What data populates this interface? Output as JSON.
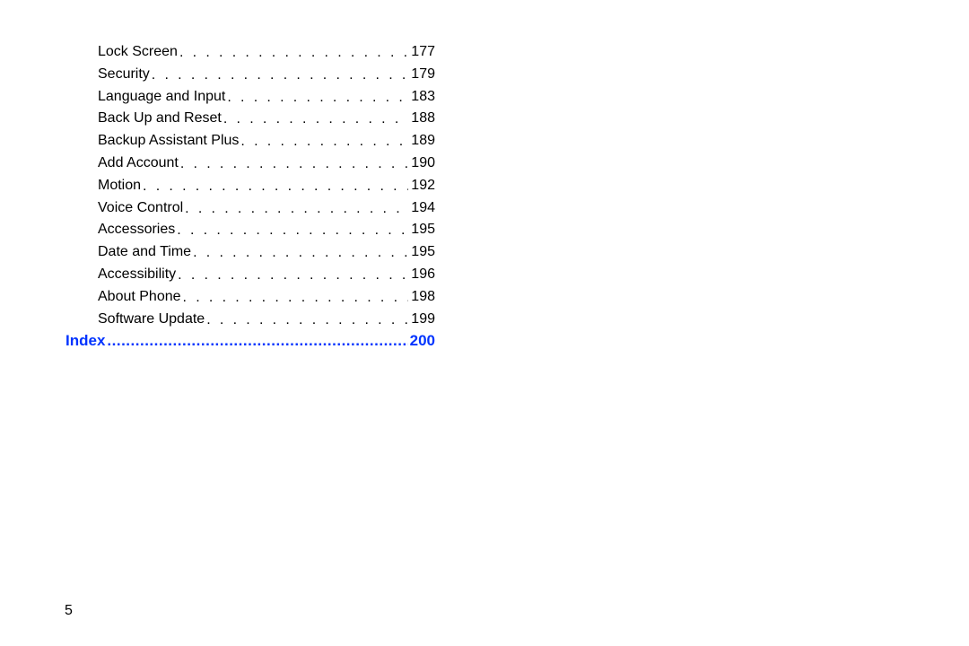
{
  "toc": {
    "entries": [
      {
        "title": "Lock Screen ",
        "page": "177"
      },
      {
        "title": "Security",
        "page": "179"
      },
      {
        "title": "Language and Input",
        "page": "183"
      },
      {
        "title": "Back Up and Reset ",
        "page": "188"
      },
      {
        "title": "Backup Assistant Plus ",
        "page": "189"
      },
      {
        "title": "Add Account ",
        "page": "190"
      },
      {
        "title": "Motion",
        "page": "192"
      },
      {
        "title": "Voice Control",
        "page": "194"
      },
      {
        "title": "Accessories",
        "page": "195"
      },
      {
        "title": "Date and Time",
        "page": "195"
      },
      {
        "title": "Accessibility ",
        "page": "196"
      },
      {
        "title": "About Phone ",
        "page": "198"
      },
      {
        "title": "Software Update ",
        "page": "199"
      }
    ],
    "index": {
      "title": "Index ",
      "page": "200"
    }
  },
  "page_number": "5"
}
